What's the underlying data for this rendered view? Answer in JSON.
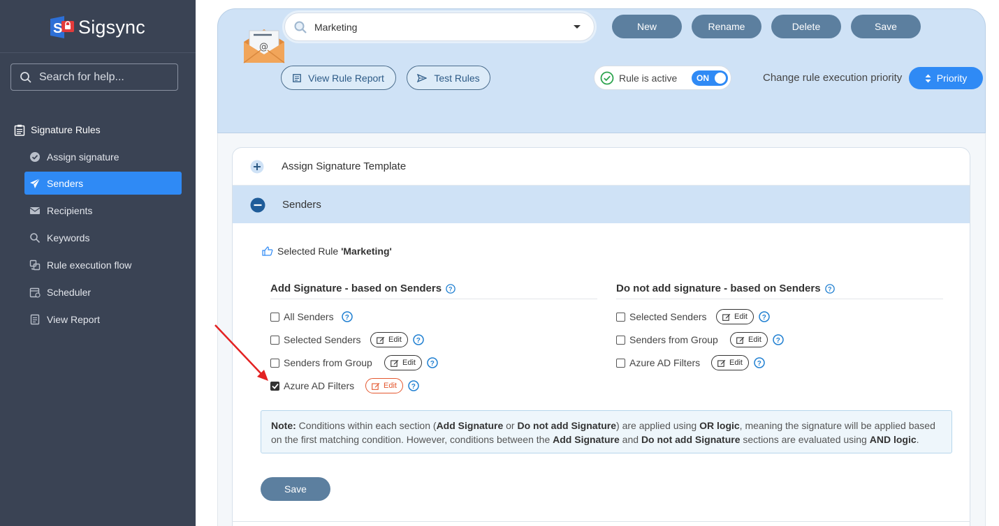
{
  "app": {
    "name": "Sigsync"
  },
  "sidebar": {
    "search_placeholder": "Search for help...",
    "section_title": "Signature Rules",
    "items": [
      {
        "label": "Assign signature",
        "icon": "check-circle-icon"
      },
      {
        "label": "Senders",
        "icon": "paper-plane-icon",
        "active": true
      },
      {
        "label": "Recipients",
        "icon": "envelope-icon"
      },
      {
        "label": "Keywords",
        "icon": "search-icon"
      },
      {
        "label": "Rule execution flow",
        "icon": "flow-icon"
      },
      {
        "label": "Scheduler",
        "icon": "calendar-icon"
      },
      {
        "label": "View Report",
        "icon": "report-icon"
      }
    ]
  },
  "toolbar": {
    "rule_select_value": "Marketing",
    "new_label": "New",
    "rename_label": "Rename",
    "delete_label": "Delete",
    "save_label": "Save",
    "view_report_label": "View Rule Report",
    "test_rules_label": "Test Rules",
    "rule_active_label": "Rule is active",
    "toggle_label": "ON",
    "priority_text": "Change rule execution priority",
    "priority_label": "Priority"
  },
  "accordion": {
    "assign_template_title": "Assign Signature Template",
    "senders_title": "Senders"
  },
  "senders": {
    "selected_rule_prefix": "Selected Rule ",
    "selected_rule_name": "'Marketing'",
    "add_title": "Add Signature - based on Senders",
    "not_add_title": "Do not add signature - based on Senders",
    "add_options": [
      {
        "label": "All Senders",
        "checked": false
      },
      {
        "label": "Selected Senders",
        "checked": false,
        "edit": "Edit"
      },
      {
        "label": "Senders from Group",
        "checked": false,
        "edit": "Edit"
      },
      {
        "label": "Azure AD Filters",
        "checked": true,
        "edit": "Edit"
      }
    ],
    "not_add_options": [
      {
        "label": "Selected Senders",
        "checked": false,
        "edit": "Edit"
      },
      {
        "label": "Senders from Group",
        "checked": false,
        "edit": "Edit"
      },
      {
        "label": "Azure AD Filters",
        "checked": false,
        "edit": "Edit"
      }
    ],
    "note": {
      "label": "Note:",
      "t1": " Conditions within each section (",
      "b1": "Add Signature",
      "t2": " or ",
      "b2": "Do not add Signature",
      "t3": ") are applied using ",
      "b3": "OR logic",
      "t4": ", meaning the signature will be applied based on the first matching condition. However, conditions between the ",
      "b4": "Add Signature",
      "t5": " and ",
      "b5": "Do not add Signature",
      "t6": " sections are evaluated using ",
      "b6": "AND logic",
      "t7": "."
    },
    "save_label": "Save"
  },
  "colors": {
    "accent": "#2f8af5",
    "sidebar": "#3a4354",
    "button": "#5c7f9f",
    "edit_highlight": "#e4572e"
  }
}
